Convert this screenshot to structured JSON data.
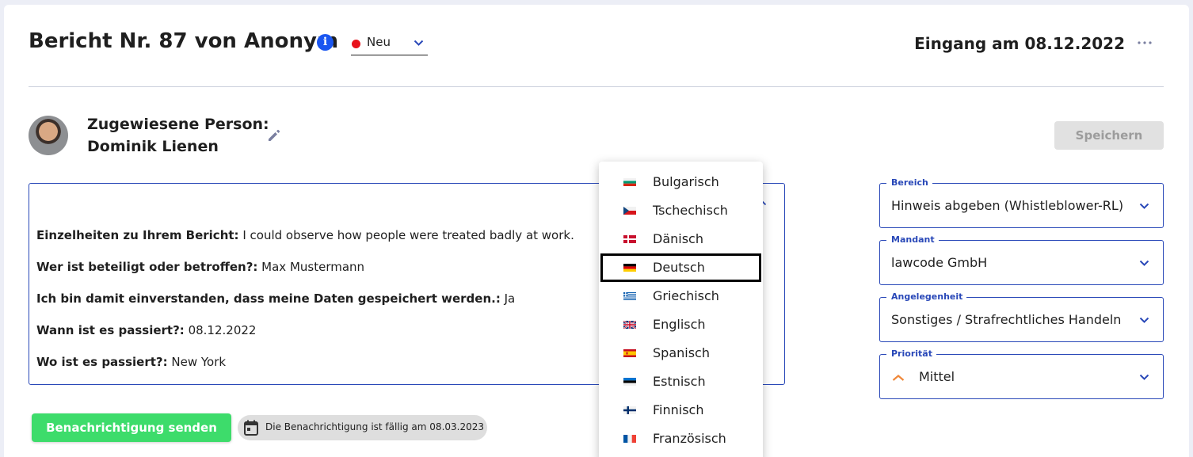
{
  "header": {
    "title": "Bericht Nr. 87 von Anonym",
    "status": {
      "label": "Neu",
      "color": "#e8131c"
    },
    "received": "Eingang am 08.12.2022"
  },
  "assignee": {
    "label": "Zugewiesene Person:",
    "name": "Dominik Lienen"
  },
  "save_label": "Speichern",
  "report": {
    "lines": [
      {
        "label": "Einzelheiten zu Ihrem Bericht:",
        "value": " I could observe how people were treated badly at work."
      },
      {
        "label": "Wer ist beteiligt oder betroffen?:",
        "value": " Max Mustermann"
      },
      {
        "label": "Ich bin damit einverstanden, dass meine Daten gespeichert werden.:",
        "value": " Ja"
      },
      {
        "label": "Wann ist es passiert?:",
        "value": " 08.12.2022"
      },
      {
        "label": "Wo ist es passiert?:",
        "value": " New York"
      }
    ]
  },
  "language_menu": {
    "selected": "Deutsch",
    "items": [
      {
        "label": "Bulgarisch",
        "flag": "bulgaria-flag-icon"
      },
      {
        "label": "Tschechisch",
        "flag": "czech-flag-icon"
      },
      {
        "label": "Dänisch",
        "flag": "denmark-flag-icon"
      },
      {
        "label": "Deutsch",
        "flag": "germany-flag-icon"
      },
      {
        "label": "Griechisch",
        "flag": "greece-flag-icon"
      },
      {
        "label": "Englisch",
        "flag": "uk-flag-icon"
      },
      {
        "label": "Spanisch",
        "flag": "spain-flag-icon"
      },
      {
        "label": "Estnisch",
        "flag": "estonia-flag-icon"
      },
      {
        "label": "Finnisch",
        "flag": "finland-flag-icon"
      },
      {
        "label": "Französisch",
        "flag": "france-flag-icon"
      }
    ]
  },
  "actions": {
    "send_label": "Benachrichtigung senden",
    "due_text": "Die Benachrichtigung ist fällig am 08.03.2023"
  },
  "fields": [
    {
      "legend": "Bereich",
      "value": "Hinweis abgeben (Whistleblower-RL)"
    },
    {
      "legend": "Mandant",
      "value": "lawcode GmbH"
    },
    {
      "legend": "Angelegenheit",
      "value": "Sonstiges / Strafrechtliches Handeln"
    },
    {
      "legend": "Priorität",
      "value": "Mittel",
      "icon": "priority-medium-icon",
      "icon_color": "#f0883a"
    }
  ],
  "colors": {
    "accent": "#2948b8",
    "info": "#1a56f0",
    "send_button": "#3ddc6b",
    "save_button_disabled": "#e1e1e1"
  }
}
